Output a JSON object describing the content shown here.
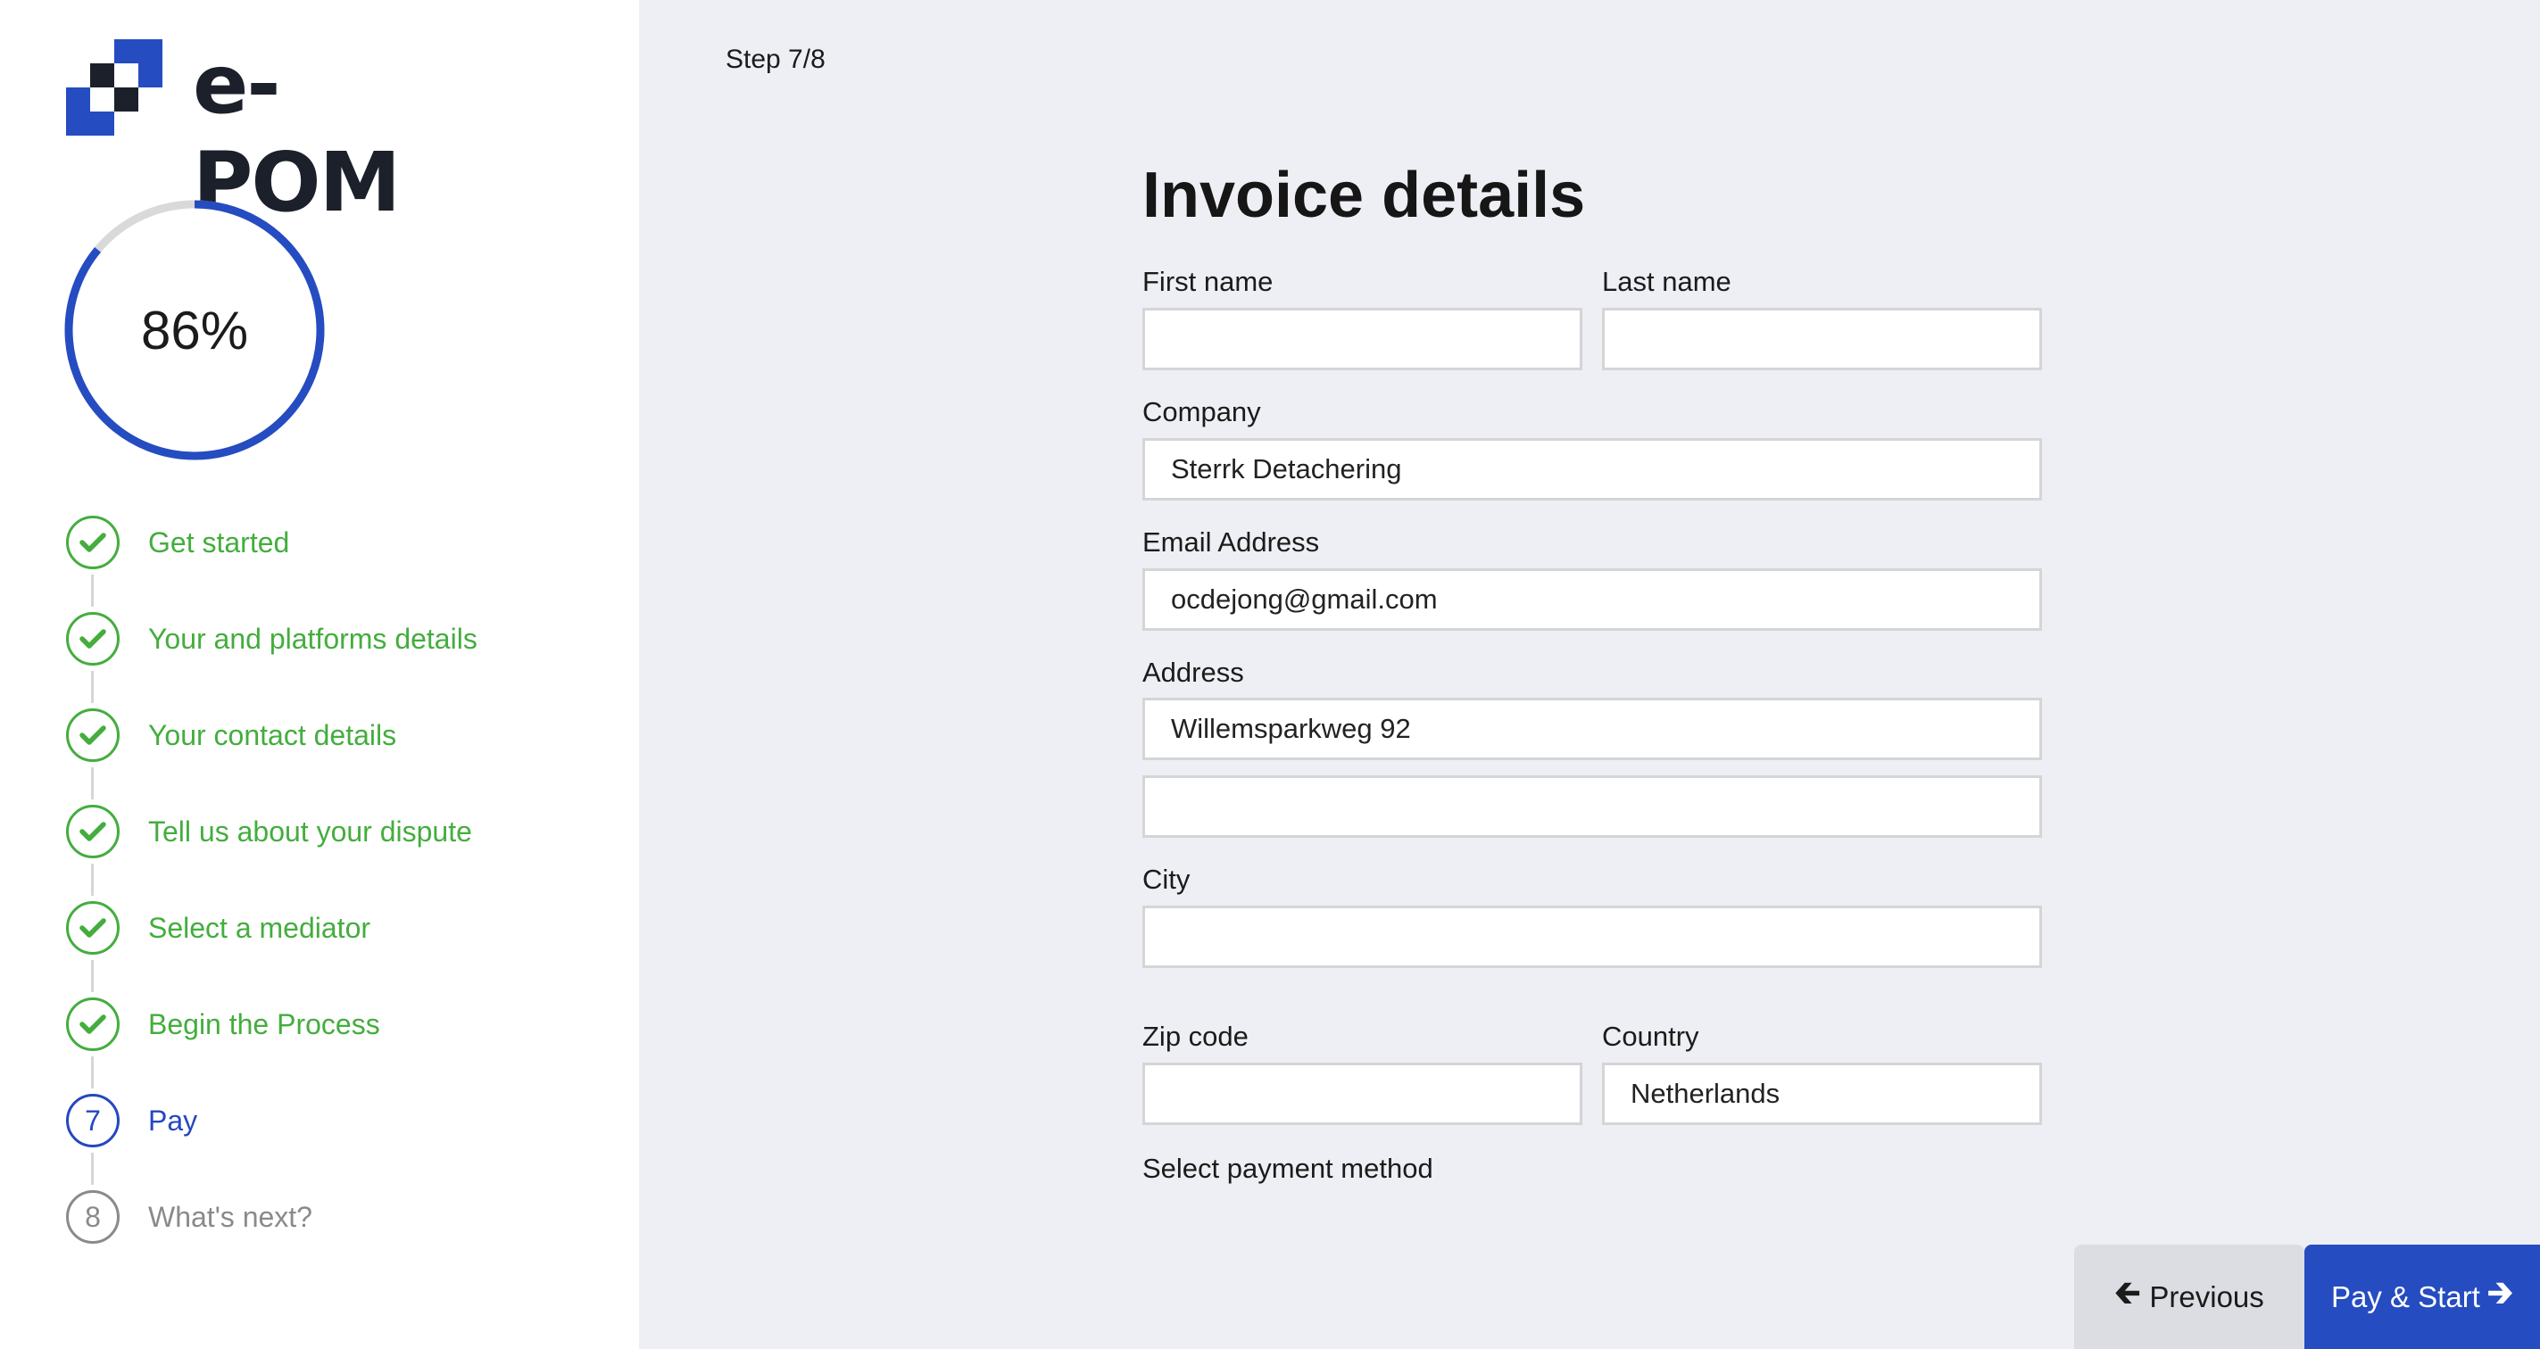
{
  "brand": {
    "name": "e-POM",
    "colors": {
      "primary": "#254cc1",
      "dark": "#1b202a",
      "success": "#44ad3e",
      "muted": "#8a8a8d"
    }
  },
  "progress": {
    "percent": 86,
    "label": "86%"
  },
  "steps": [
    {
      "number": "1",
      "label": "Get started",
      "status": "done",
      "icon": "check-icon"
    },
    {
      "number": "2",
      "label": "Your and platforms details",
      "status": "done",
      "icon": "check-icon"
    },
    {
      "number": "3",
      "label": "Your contact details",
      "status": "done",
      "icon": "check-icon"
    },
    {
      "number": "4",
      "label": "Tell us about your dispute",
      "status": "done",
      "icon": "check-icon"
    },
    {
      "number": "5",
      "label": "Select a mediator",
      "status": "done",
      "icon": "check-icon"
    },
    {
      "number": "6",
      "label": "Begin the Process",
      "status": "done",
      "icon": "check-icon"
    },
    {
      "number": "7",
      "label": "Pay",
      "status": "active"
    },
    {
      "number": "8",
      "label": "What's next?",
      "status": "pending"
    }
  ],
  "header": {
    "step_counter": "Step 7/8"
  },
  "form": {
    "title": "Invoice details",
    "fields": {
      "first_name": {
        "label": "First name",
        "value": ""
      },
      "last_name": {
        "label": "Last name",
        "value": ""
      },
      "company": {
        "label": "Company",
        "value": "Sterrk Detachering"
      },
      "email": {
        "label": "Email Address",
        "value": "ocdejong@gmail.com"
      },
      "address": {
        "label": "Address",
        "value_line1": "Willemsparkweg 92",
        "value_line2": ""
      },
      "city": {
        "label": "City",
        "value": ""
      },
      "zip": {
        "label": "Zip code",
        "value": ""
      },
      "country": {
        "label": "Country",
        "value": "Netherlands"
      }
    },
    "payment_method_label": "Select payment method"
  },
  "actions": {
    "previous_label": "Previous",
    "previous_icon": "arrow-left-icon",
    "pay_label": "Pay & Start",
    "pay_icon": "arrow-right-icon"
  }
}
